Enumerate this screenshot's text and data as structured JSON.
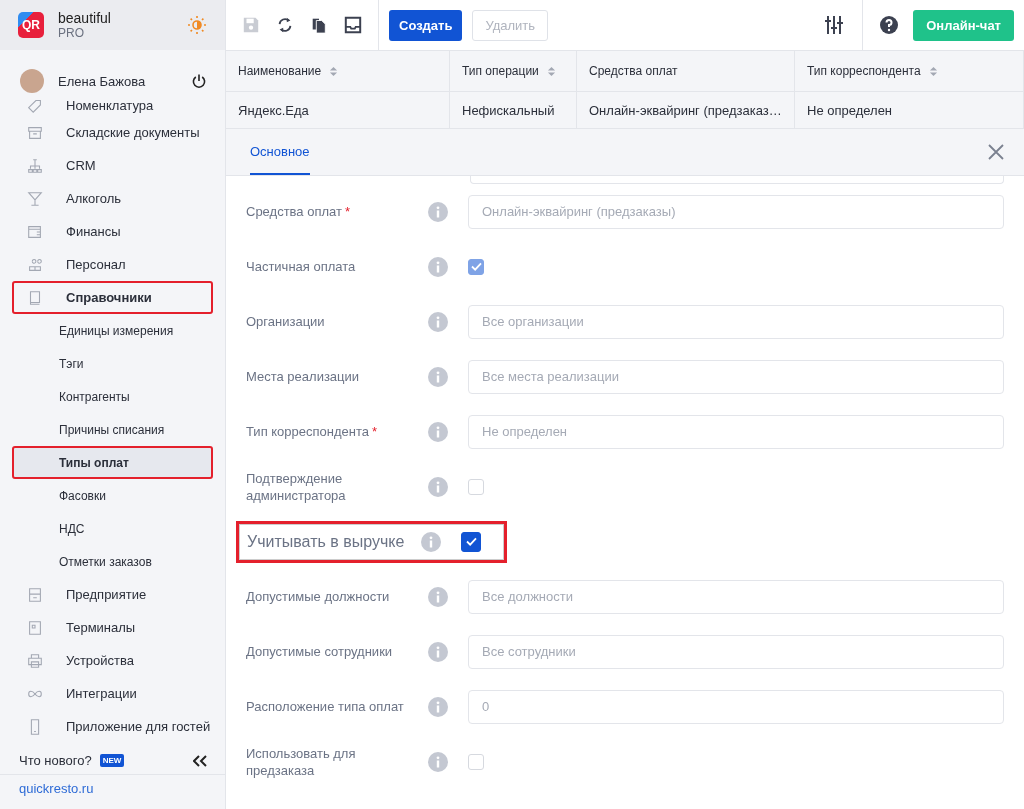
{
  "brand": {
    "name": "beautiful",
    "plan": "PRO",
    "logo": "QR"
  },
  "user": {
    "name": "Елена Бажова"
  },
  "sidebar": {
    "items": [
      {
        "label": "Номенклатура",
        "kind": "tag",
        "highlighted": false
      },
      {
        "label": "Складские документы",
        "kind": "archive",
        "highlighted": false
      },
      {
        "label": "CRM",
        "kind": "hierarchy",
        "highlighted": false
      },
      {
        "label": "Алкоголь",
        "kind": "glass",
        "highlighted": false
      },
      {
        "label": "Финансы",
        "kind": "wallet",
        "highlighted": false
      },
      {
        "label": "Персонал",
        "kind": "people",
        "highlighted": false
      },
      {
        "label": "Справочники",
        "kind": "book",
        "highlighted": true,
        "children": [
          {
            "label": "Единицы измерения",
            "selected": false,
            "highlighted": false
          },
          {
            "label": "Тэги",
            "selected": false,
            "highlighted": false
          },
          {
            "label": "Контрагенты",
            "selected": false,
            "highlighted": false
          },
          {
            "label": "Причины списания",
            "selected": false,
            "highlighted": false
          },
          {
            "label": "Типы оплат",
            "selected": true,
            "highlighted": true
          },
          {
            "label": "Фасовки",
            "selected": false,
            "highlighted": false
          },
          {
            "label": "НДС",
            "selected": false,
            "highlighted": false
          },
          {
            "label": "Отметки заказов",
            "selected": false,
            "highlighted": false
          }
        ]
      },
      {
        "label": "Предприятие",
        "kind": "store",
        "highlighted": false
      },
      {
        "label": "Терминалы",
        "kind": "qr",
        "highlighted": false
      },
      {
        "label": "Устройства",
        "kind": "printer",
        "highlighted": false
      },
      {
        "label": "Интеграции",
        "kind": "infinity",
        "highlighted": false
      },
      {
        "label": "Приложение для гостей",
        "kind": "phone",
        "highlighted": false
      }
    ],
    "whats_new": "Что нового?",
    "new_badge": "NEW",
    "site_link": "quickresto.ru"
  },
  "toolbar": {
    "create": "Создать",
    "delete": "Удалить",
    "delete_disabled": true,
    "save_disabled": true,
    "chat": "Онлайн-чат"
  },
  "table": {
    "columns": [
      {
        "label": "Наименование",
        "sortable": true
      },
      {
        "label": "Тип операции",
        "sortable": true
      },
      {
        "label": "Средства оплат",
        "sortable": false
      },
      {
        "label": "Тип корреспондента",
        "sortable": true
      }
    ],
    "rows": [
      [
        "Яндекс.Еда",
        "Нефискальный",
        "Онлайн-эквайринг (предзаказ…",
        "Не определен"
      ]
    ]
  },
  "panel": {
    "tabs": [
      {
        "label": "Основное",
        "selected": true
      }
    ],
    "fields": [
      {
        "kind": "field",
        "label": "Средства оплат",
        "required_mark": "*",
        "placeholder": "Онлайн-эквайринг (предзаказы)",
        "highlighted": false
      },
      {
        "kind": "checkbox",
        "label": "Частичная оплата",
        "checked": true,
        "disabled": true,
        "highlighted": false
      },
      {
        "kind": "field",
        "label": "Организации",
        "placeholder": "Все организации",
        "highlighted": false
      },
      {
        "kind": "field",
        "label": "Места реализации",
        "placeholder": "Все места реализации",
        "highlighted": false
      },
      {
        "kind": "field",
        "label": "Тип корреспондента",
        "required_mark": "*",
        "placeholder": "Не определен",
        "highlighted": false
      },
      {
        "kind": "checkbox",
        "label": "Подтверждение администратора",
        "checked": false,
        "disabled": false,
        "highlighted": false
      },
      {
        "kind": "checkbox",
        "label": "Учитывать в выручке",
        "checked": true,
        "disabled": false,
        "highlighted": true
      },
      {
        "kind": "field",
        "label": "Допустимые должности",
        "placeholder": "Все должности",
        "highlighted": false
      },
      {
        "kind": "field",
        "label": "Допустимые сотрудники",
        "placeholder": "Все сотрудники",
        "highlighted": false
      },
      {
        "kind": "field",
        "label": "Расположение типа оплат",
        "placeholder": "0",
        "highlighted": false
      },
      {
        "kind": "checkbox",
        "label": "Использовать для предзаказа",
        "checked": false,
        "disabled": false,
        "highlighted": false
      }
    ]
  }
}
